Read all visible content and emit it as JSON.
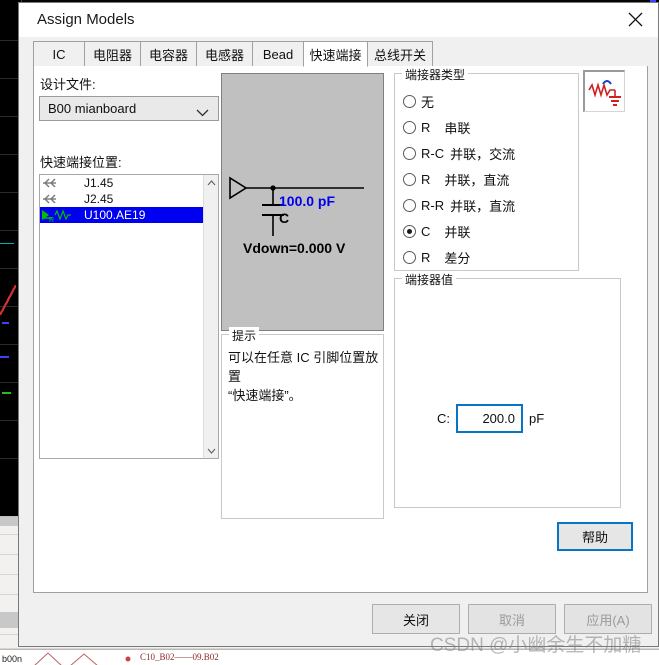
{
  "window": {
    "title": "Assign Models",
    "close_icon": "close-icon"
  },
  "tabs": [
    {
      "label": "IC",
      "active": false
    },
    {
      "label": "电阻器",
      "active": false
    },
    {
      "label": "电容器",
      "active": false
    },
    {
      "label": "电感器",
      "active": false
    },
    {
      "label": "Bead",
      "active": false
    },
    {
      "label": "快速端接",
      "active": true
    },
    {
      "label": "总线开关",
      "active": false
    }
  ],
  "design_file": {
    "label": "设计文件:",
    "value": "B00 mianboard",
    "chevron_icon": "chevron-down-icon"
  },
  "quick_terminator": {
    "label": "快速端接位置:",
    "items": [
      {
        "text": "J1.45",
        "selected": false,
        "icon": "pin-arrow-icon"
      },
      {
        "text": "J2.45",
        "selected": false,
        "icon": "pin-arrow-icon"
      },
      {
        "text": "U100.AE19",
        "selected": true,
        "icon": "resistor-pin-icon"
      }
    ],
    "scroll_up_icon": "chevron-up-icon",
    "scroll_down_icon": "chevron-down-icon"
  },
  "preview": {
    "cap_value": "100.0 pF",
    "cap_ref": "C",
    "vdown": "Vdown=0.000 V",
    "value_color": "#0000ee"
  },
  "tip": {
    "title": "提示",
    "line1": "可以在任意 IC 引脚位置放置",
    "line2": "“快速端接”。"
  },
  "terminator_type": {
    "title": "端接器类型",
    "options": [
      {
        "a": "无",
        "b": "",
        "selected": false
      },
      {
        "a": "R",
        "b": "串联",
        "selected": false
      },
      {
        "a": "R-C",
        "b": "并联，交流",
        "selected": false
      },
      {
        "a": "R",
        "b": "并联，直流",
        "selected": false
      },
      {
        "a": "R-R",
        "b": "并联，直流",
        "selected": false
      },
      {
        "a": "C",
        "b": "并联",
        "selected": true
      },
      {
        "a": "R",
        "b": "差分",
        "selected": false
      }
    ]
  },
  "circuit_icon_button": {
    "icon": "rc-circuit-icon"
  },
  "terminator_value": {
    "title": "端接器值",
    "field_label": "C:",
    "value": "200.0",
    "unit": "pF"
  },
  "help_button": {
    "label": "帮助"
  },
  "footer": {
    "close": "关闭",
    "cancel": "取消",
    "apply": "应用(A)"
  },
  "watermark": {
    "text": "CSDN @小幽余生不加糖"
  },
  "background": {
    "bottom_schematic_text": "C10_B02——09.B02"
  },
  "colors": {
    "accent_blue": "#0a74c4",
    "selection_blue": "#0000f0",
    "preview_bg": "#c0c0c0",
    "dialog_bg": "#f0f0f0"
  }
}
